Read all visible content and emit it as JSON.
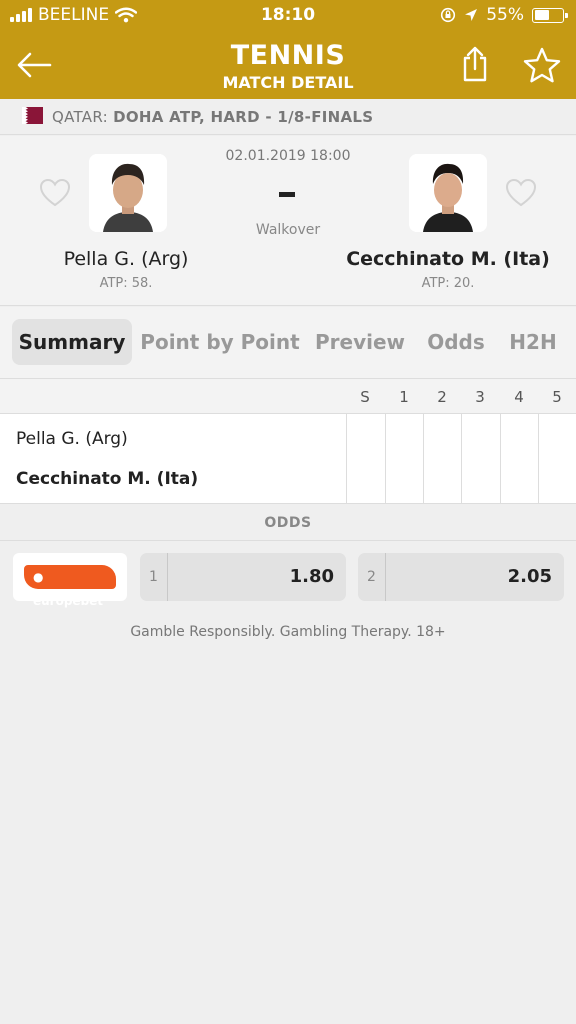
{
  "status_bar": {
    "carrier": "BEELINE",
    "time": "18:10",
    "battery": "55%",
    "battery_level": 0.55
  },
  "header": {
    "title": "TENNIS",
    "subtitle": "MATCH DETAIL",
    "icons": [
      "back-arrow-icon",
      "share-icon",
      "star-icon"
    ]
  },
  "tournament": {
    "country": "QATAR:",
    "name": "DOHA ATP, HARD - 1/8-FINALS"
  },
  "match": {
    "datetime": "02.01.2019 18:00",
    "score": "-",
    "status": "Walkover",
    "home": {
      "name": "Pella G. (Arg)",
      "rank": "ATP: 58."
    },
    "away": {
      "name": "Cecchinato M. (Ita)",
      "rank": "ATP: 20."
    }
  },
  "tabs": [
    "Summary",
    "Point by Point",
    "Preview",
    "Odds",
    "H2H"
  ],
  "score_table": {
    "columns": [
      "S",
      "1",
      "2",
      "3",
      "4",
      "5"
    ],
    "rows": [
      {
        "name": "Pella G. (Arg)"
      },
      {
        "name": "Cecchinato M. (Ita)"
      }
    ]
  },
  "odds": {
    "header": "ODDS",
    "bookmaker": "europebet",
    "items": [
      {
        "label": "1",
        "value": "1.80"
      },
      {
        "label": "2",
        "value": "2.05"
      }
    ]
  },
  "disclaimer": "Gamble Responsibly. Gambling Therapy. 18+",
  "colors": {
    "header": "#c59a14",
    "bookmaker_brand": "#ef5a1f",
    "flag": "#8a1538"
  }
}
